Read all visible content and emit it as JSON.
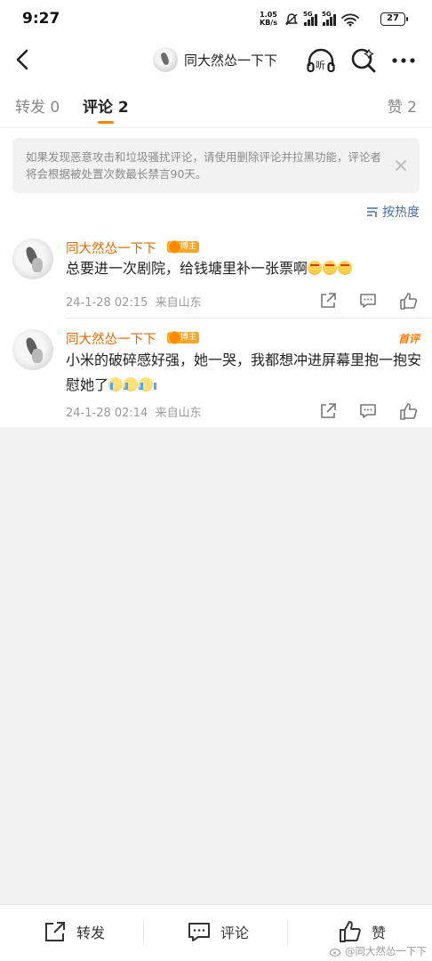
{
  "status_bar": {
    "time": "9:27",
    "net_speed_value": "1.05",
    "net_speed_unit": "KB/s",
    "signal_1": "5G",
    "signal_2": "5G",
    "battery": "27"
  },
  "nav": {
    "title": "同大然怂一下下",
    "icons": [
      "back-icon",
      "listen-icon",
      "search-icon",
      "more-icon"
    ]
  },
  "tabs": {
    "repost": "转发 0",
    "comment": "评论 2",
    "like": "赞 2"
  },
  "notice": {
    "text": "如果发现恶意攻击和垃圾骚扰评论，请使用删除评论并拉黑功能，评论者将会根据被处置次数最长禁言90天。"
  },
  "sort": {
    "label": "按热度"
  },
  "comments": [
    {
      "user": "同大然怂一下下",
      "badge": "博主",
      "text": "总要进一次剧院，给钱塘里补一张票啊",
      "emojis": [
        "angry",
        "angry",
        "angry"
      ],
      "date": "24-1-28 02:15",
      "location": "来自山东",
      "flag": ""
    },
    {
      "user": "同大然怂一下下",
      "badge": "博主",
      "text": "小米的破碎感好强，她一哭，我都想冲进屏幕里抱一抱安慰她了",
      "emojis": [
        "cry",
        "cry",
        "cry"
      ],
      "date": "24-1-28 02:14",
      "location": "来自山东",
      "flag": "首评"
    }
  ],
  "bottom_bar": {
    "repost": "转发",
    "comment": "评论",
    "like": "赞"
  },
  "watermark": "@同大然怂一下下",
  "colors": {
    "accent": "#ff8200",
    "username": "#e86a00",
    "link": "#4a6fa5",
    "page_bg": "#f2f2f2"
  }
}
